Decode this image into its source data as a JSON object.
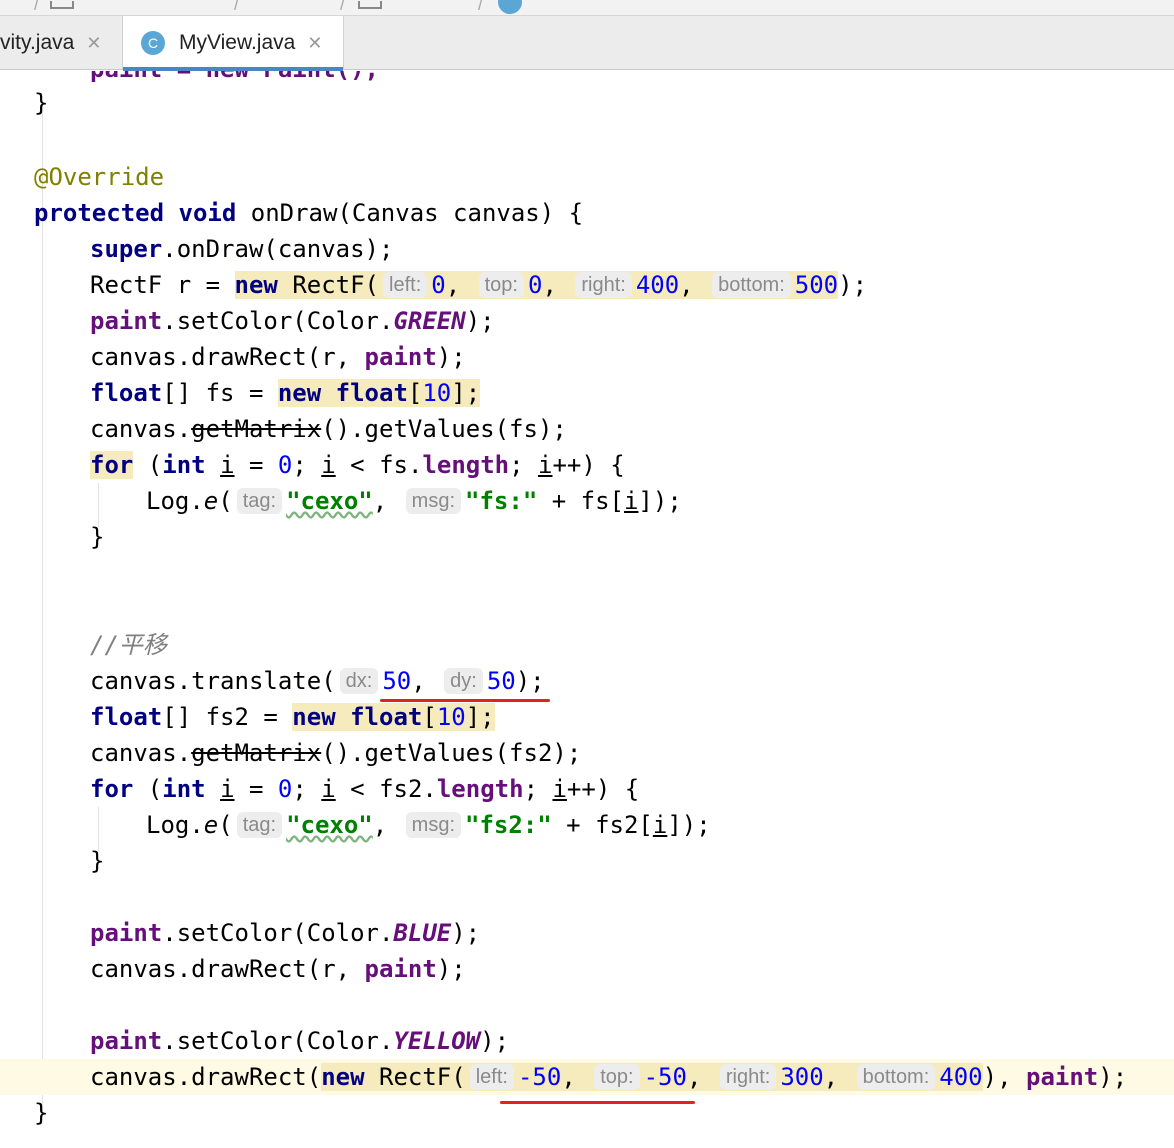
{
  "tabs": [
    {
      "label": "vity.java",
      "close": "✕"
    },
    {
      "label": "MyView.java",
      "close": "✕",
      "badge": "C"
    }
  ],
  "code": {
    "line_cut": "paint = new Paint();",
    "brace_close": "}",
    "override": "@Override",
    "kw_protected": "protected",
    "kw_void": "void",
    "on_draw_sig": "onDraw(Canvas canvas) {",
    "kw_super": "super",
    "super_call": ".onDraw(canvas);",
    "rectf_decl": "RectF r = ",
    "kw_new": "new",
    "rectf_ctor": "RectF(",
    "hint_left": "left:",
    "hint_top": "top:",
    "hint_right": "right:",
    "hint_bottom": "bottom:",
    "v0": "0",
    "v400": "400",
    "v500": "500",
    "comma": ",",
    "close_paren_semi": ");",
    "paint": "paint",
    "set_color": ".setColor(Color.",
    "green": "GREEN",
    "blue": "BLUE",
    "yellow": "YELLOW",
    "draw_rect_r": "canvas.drawRect(r, ",
    "kw_float": "float",
    "arr_fs": "[] fs = ",
    "arr_fs2": "[] fs2 = ",
    "bracket_open": "[",
    "v10": "10",
    "bracket_close_semi": "];",
    "canvas_dot": "canvas.",
    "get_matrix": "getMatrix",
    "get_values_fs": "().getValues(fs);",
    "get_values_fs2": "().getValues(fs2);",
    "kw_for": "for",
    "kw_int": "int",
    "var_i": "i",
    "fs_length": "fs.",
    "fs2_length": "fs2.",
    "length": "length",
    "log_e": "Log.",
    "e": "e",
    "hint_tag": "tag:",
    "hint_msg": "msg:",
    "str_cexo": "\"cexo\"",
    "str_fs": "\"fs:\"",
    "str_fs2": "\"fs2:\"",
    "plus_fs": " + fs[",
    "plus_fs2": " + fs2[",
    "comment_translate": "//平移",
    "translate": "canvas.translate(",
    "hint_dx": "dx:",
    "hint_dy": "dy:",
    "v50": "50",
    "draw_rect_new": "canvas.drawRect(",
    "vneg50": "-50",
    "v300": "300"
  }
}
